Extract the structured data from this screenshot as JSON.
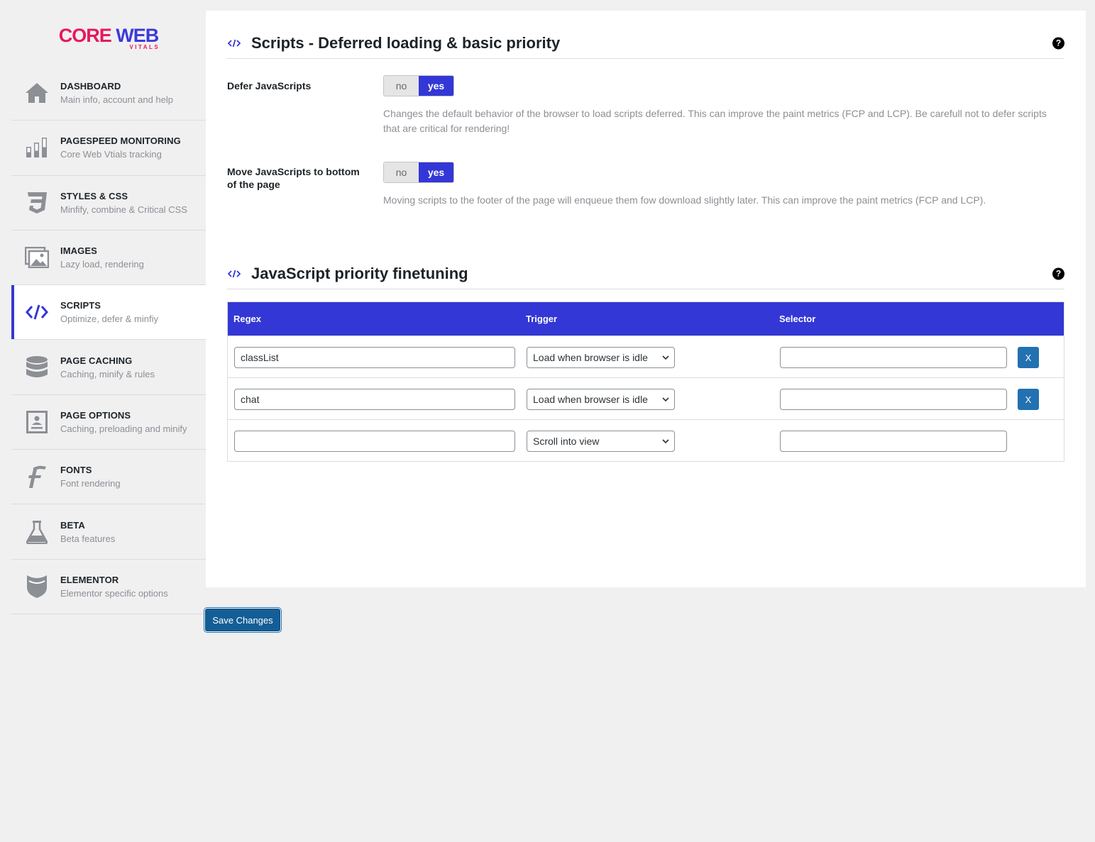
{
  "logo": {
    "core": "CORE",
    "web": "WEB",
    "sub": "VITALS"
  },
  "sidebar": {
    "items": [
      {
        "title": "DASHBOARD",
        "subtitle": "Main info, account and help",
        "icon": "home-icon"
      },
      {
        "title": "PAGESPEED MONITORING",
        "subtitle": "Core Web Vtials tracking",
        "icon": "bar-chart-icon"
      },
      {
        "title": "STYLES & CSS",
        "subtitle": "Minfify, combine & Critical CSS",
        "icon": "css3-icon"
      },
      {
        "title": "IMAGES",
        "subtitle": "Lazy load, rendering",
        "icon": "image-icon"
      },
      {
        "title": "SCRIPTS",
        "subtitle": "Optimize, defer & minfiy",
        "icon": "code-icon",
        "active": true
      },
      {
        "title": "PAGE CACHING",
        "subtitle": "Caching, minify & rules",
        "icon": "database-icon"
      },
      {
        "title": "PAGE OPTIONS",
        "subtitle": "Caching, preloading and minify",
        "icon": "page-icon"
      },
      {
        "title": "FONTS",
        "subtitle": "Font rendering",
        "icon": "font-icon"
      },
      {
        "title": "BETA",
        "subtitle": "Beta features",
        "icon": "flask-icon"
      },
      {
        "title": "ELEMENTOR",
        "subtitle": "Elementor specific options",
        "icon": "elementor-icon"
      }
    ]
  },
  "section1": {
    "title": "Scripts - Deferred loading & basic priority",
    "help": "?",
    "settings": [
      {
        "label": "Defer JavaScripts",
        "no": "no",
        "yes": "yes",
        "value": "yes",
        "description": "Changes the default behavior of the browser to load scripts deferred. This can improve the paint metrics (FCP and LCP). Be carefull not to defer scripts that are critical for rendering!"
      },
      {
        "label": "Move JavaScripts to bottom of the page",
        "no": "no",
        "yes": "yes",
        "value": "yes",
        "description": "Moving scripts to the footer of the page will enqueue them fow download slightly later. This can improve the paint metrics (FCP and LCP)."
      }
    ]
  },
  "section2": {
    "title": "JavaScript priority finetuning",
    "help": "?",
    "table": {
      "headers": {
        "regex": "Regex",
        "trigger": "Trigger",
        "selector": "Selector"
      },
      "rows": [
        {
          "regex": "classList",
          "trigger": "Load when browser is idle",
          "selector": "",
          "remove": "X"
        },
        {
          "regex": "chat",
          "trigger": "Load when browser is idle",
          "selector": "",
          "remove": "X"
        },
        {
          "regex": "",
          "trigger": "Scroll into view",
          "selector": ""
        }
      ]
    }
  },
  "save_label": "Save Changes",
  "colors": {
    "accent": "#3337d6",
    "brand_pink": "#e8175d",
    "button_blue": "#2271b1"
  }
}
